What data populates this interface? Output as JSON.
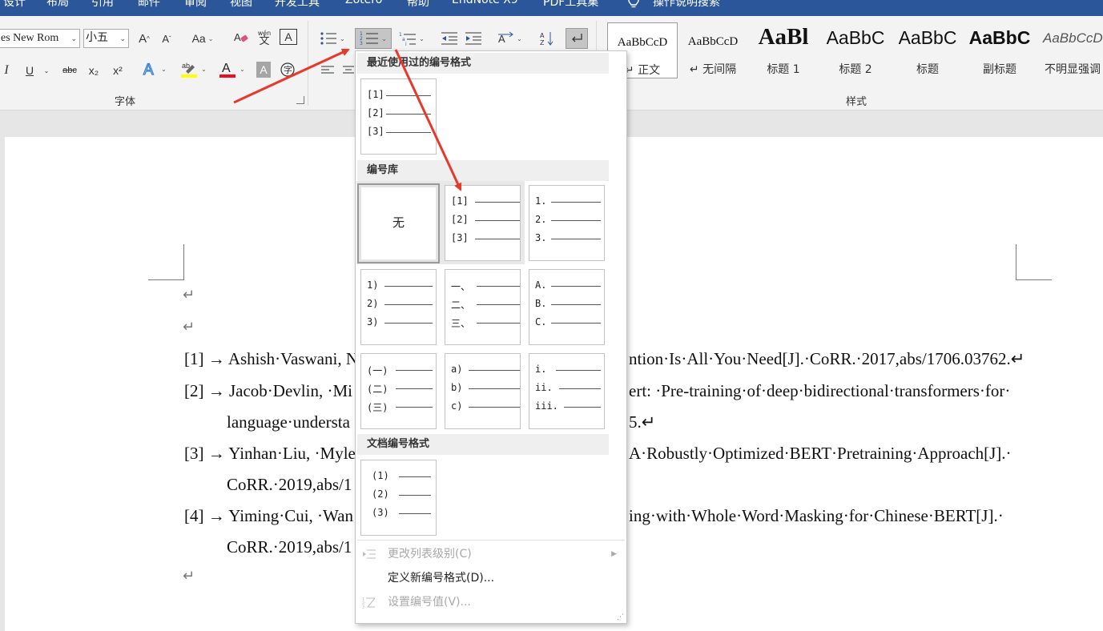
{
  "menubar": {
    "tabs": [
      "设计",
      "布局",
      "引用",
      "邮件",
      "审阅",
      "视图",
      "开发工具",
      "Zotero",
      "帮助",
      "EndNote X9",
      "PDF工具集",
      "操作说明搜索"
    ]
  },
  "ribbon": {
    "font_name": "es New Rom",
    "font_size": "小五",
    "font_group_label": "字体",
    "styles_group_label": "样式",
    "aa_label": "Aa",
    "phonetic_label": "wén",
    "phonetic_char": "文",
    "format_buttons": {
      "italic": "I",
      "underline": "U",
      "strike": "abc",
      "subscript": "x₂",
      "superscript": "x²"
    },
    "styles": [
      {
        "sample": "AaBbCcD",
        "name": "↵ 正文"
      },
      {
        "sample": "AaBbCcD",
        "name": "↵ 无间隔"
      },
      {
        "sample": "AaBl",
        "name": "标题 1"
      },
      {
        "sample": "AaBbC",
        "name": "标题 2"
      },
      {
        "sample": "AaBbC",
        "name": "标题"
      },
      {
        "sample": "AaBbC",
        "name": "副标题"
      },
      {
        "sample": "AaBbCcDd",
        "name": "不明显强调"
      }
    ]
  },
  "document": {
    "paragraphs": [
      "[1] → Ashish·Vaswani, N",
      "ntion·Is·All·You·Need[J].·CoRR.·2017,abs/1706.03762.↵",
      "[2] → Jacob·Devlin, ·Mi",
      "ert: ·Pre-training·of·deep·bidirectional·transformers·for·",
      "language·understa",
      "5.↵",
      "[3] → Yinhan·Liu, ·Myle",
      "A·Robustly·Optimized·BERT·Pretraining·Approach[J].·",
      "CoRR.·2019,abs/1",
      "[4] → Yiming·Cui, ·Wan",
      "ing·with·Whole·Word·Masking·for·Chinese·BERT[J].·",
      "CoRR.·2019,abs/1"
    ],
    "return_mark": "↵"
  },
  "numbering_menu": {
    "recent_header": "最近使用过的编号格式",
    "library_header": "编号库",
    "document_header": "文档编号格式",
    "none_label": "无",
    "recent": [
      [
        "[1]",
        "[2]",
        "[3]"
      ]
    ],
    "library": [
      [
        "[1]",
        "[2]",
        "[3]"
      ],
      [
        "1.",
        "2.",
        "3."
      ],
      [
        "1)",
        "2)",
        "3)"
      ],
      [
        "一、",
        "二、",
        "三、"
      ],
      [
        "A.",
        "B.",
        "C."
      ],
      [
        "(一)",
        "(二)",
        "(三)"
      ],
      [
        "a)",
        "b)",
        "c)"
      ],
      [
        "i.",
        "ii.",
        "iii."
      ]
    ],
    "document": [
      [
        "(1)",
        "(2)",
        "(3)"
      ]
    ],
    "items": [
      {
        "label": "更改列表级别(C)",
        "enabled": false,
        "icon": "change-level-icon"
      },
      {
        "label": "定义新编号格式(D)...",
        "enabled": true,
        "icon": ""
      },
      {
        "label": "设置编号值(V)...",
        "enabled": false,
        "icon": "set-value-icon"
      }
    ]
  },
  "colors": {
    "tab_bar": "#2b579a",
    "annotation_arrow": "#e8382b",
    "font_color_bar": "#e81123",
    "highlight_bar": "#ffff00"
  }
}
